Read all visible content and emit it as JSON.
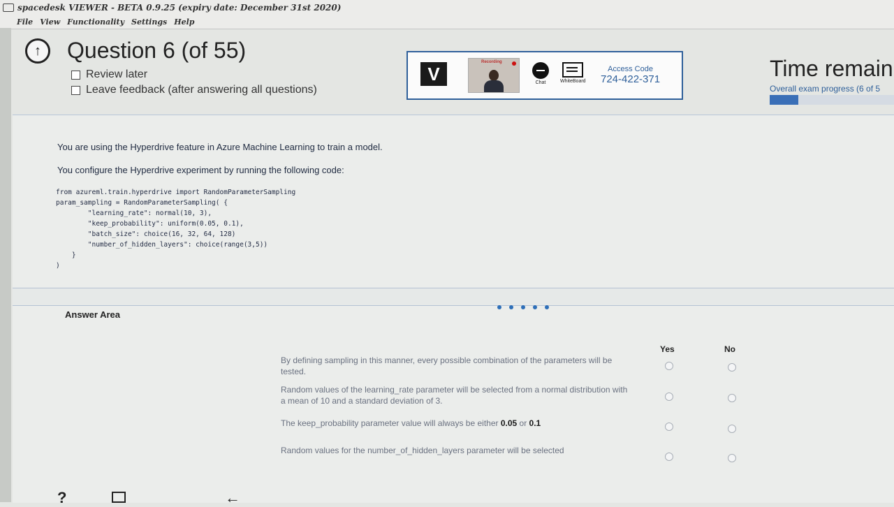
{
  "window": {
    "title": "spacedesk VIEWER - BETA 0.9.25 (expiry date: December 31st 2020)",
    "menu": [
      "File",
      "View",
      "Functionality",
      "Settings",
      "Help"
    ]
  },
  "header": {
    "question_title": "Question 6 (of 55)",
    "review_later": "Review later",
    "leave_feedback": "Leave feedback (after answering all questions)"
  },
  "proctor": {
    "logo_letter": "V",
    "recording_label": "Recording",
    "chat_label": "Chat",
    "whiteboard_label": "WhiteBoard",
    "access_code_label": "Access Code",
    "access_code": "724-422-371"
  },
  "exam": {
    "time_title": "Time remain",
    "progress_label": "Overall exam progress (6 of 5",
    "progress_fraction": 0.23
  },
  "question": {
    "intro1": "You are using the Hyperdrive feature in Azure Machine Learning to train a model.",
    "intro2": "You configure the Hyperdrive experiment by running the following code:",
    "code": "from azureml.train.hyperdrive import RandomParameterSampling\nparam_sampling = RandomParameterSampling( {\n        \"learning_rate\": normal(10, 3),\n        \"keep_probability\": uniform(0.05, 0.1),\n        \"batch_size\": choice(16, 32, 64, 128)\n        \"number_of_hidden_layers\": choice(range(3,5))\n    }\n)"
  },
  "answer_area": {
    "title": "Answer Area",
    "yes_label": "Yes",
    "no_label": "No",
    "statements": [
      {
        "text": "By defining sampling in this manner, every possible combination of the parameters will be tested."
      },
      {
        "text": "Random values of the learning_rate parameter will be selected from a normal distribution with a mean of 10 and a standard deviation of 3."
      },
      {
        "prefix": "The keep_probability parameter value will always be either ",
        "val1": "0.05",
        "mid": " or ",
        "val2": "0.1"
      },
      {
        "text": "Random values for the number_of_hidden_layers parameter will be selected"
      }
    ]
  },
  "bottom_bar": {
    "help_icon": "?",
    "calculator_icon": "calculator-icon",
    "back_icon": "back-arrow-icon"
  }
}
